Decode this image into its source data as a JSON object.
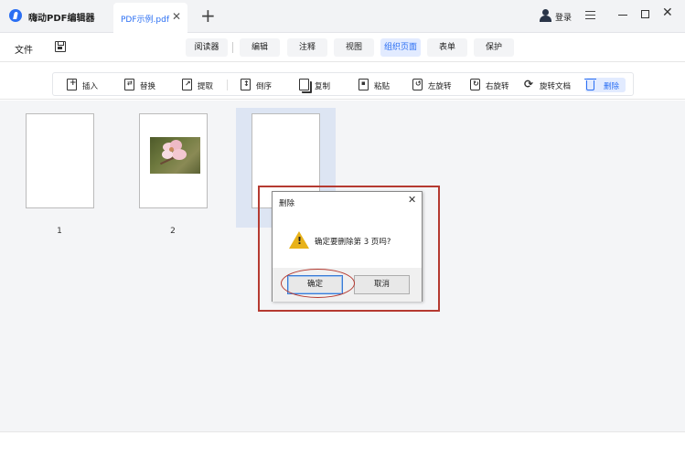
{
  "titlebar": {
    "app_title": "嗨动PDF编辑器",
    "doc_tab": "PDF示例.pdf",
    "tab_close": "✕",
    "new_tab": "+",
    "login_label": "登录",
    "close_glyph": "✕"
  },
  "menubar": {
    "file": "文件",
    "modes": [
      "阅读器",
      "编辑",
      "注释",
      "视图",
      "组织页面",
      "表单",
      "保护"
    ],
    "active_mode": "组织页面"
  },
  "toolbar": {
    "tools": [
      {
        "label": "插入",
        "icon": "insert-page-icon"
      },
      {
        "label": "替换",
        "icon": "replace-page-icon"
      },
      {
        "label": "提取",
        "icon": "extract-page-icon"
      },
      {
        "label": "倒序",
        "icon": "reverse-order-icon"
      },
      {
        "label": "复制",
        "icon": "copy-page-icon"
      },
      {
        "label": "粘贴",
        "icon": "paste-page-icon"
      },
      {
        "label": "左旋转",
        "icon": "rotate-left-icon"
      },
      {
        "label": "右旋转",
        "icon": "rotate-right-icon"
      },
      {
        "label": "旋转文档",
        "icon": "rotate-document-icon"
      },
      {
        "label": "删除",
        "icon": "trash-icon"
      }
    ],
    "active_tool": "删除"
  },
  "pages": [
    {
      "number": "1"
    },
    {
      "number": "2"
    }
  ],
  "dialog": {
    "title": "删除",
    "close": "✕",
    "message": "确定要删除第 3 页吗?",
    "ok_label": "确定",
    "cancel_label": "取消"
  },
  "colors": {
    "accent": "#2b6ff3",
    "annotation_red": "#b53a31",
    "warning_yellow": "#e8b21a"
  }
}
